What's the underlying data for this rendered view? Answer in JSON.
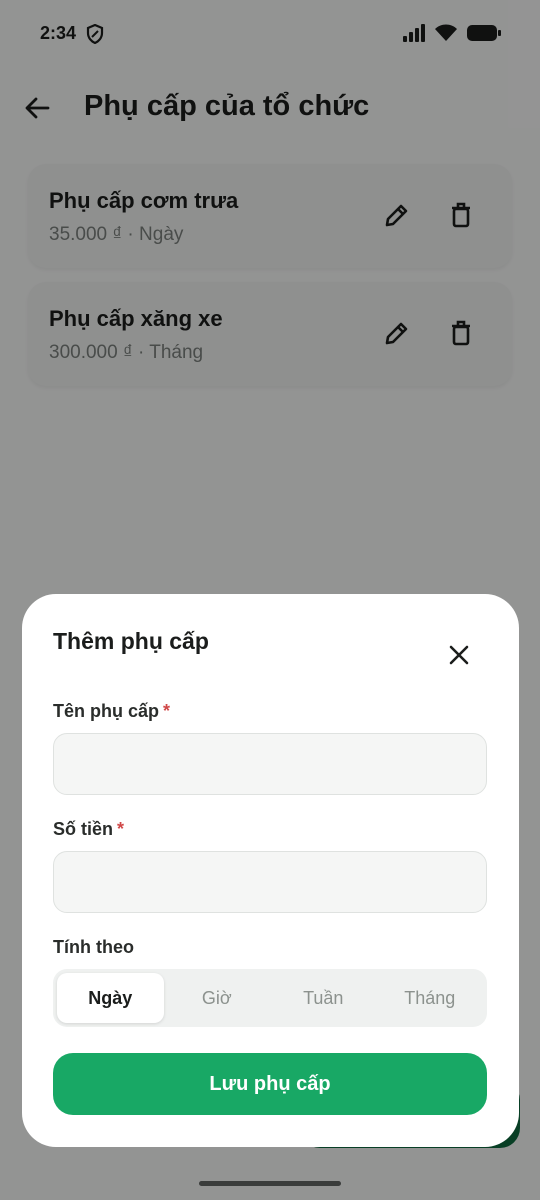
{
  "status": {
    "time": "2:34"
  },
  "header": {
    "title": "Phụ cấp của tổ chức"
  },
  "allowances": [
    {
      "name": "Phụ cấp cơm trưa",
      "detail": "35.000 ₫ · Ngày"
    },
    {
      "name": "Phụ cấp xăng xe",
      "detail": "300.000 ₫ · Tháng"
    }
  ],
  "sheet": {
    "title": "Thêm phụ cấp",
    "name_label": "Tên phụ cấp",
    "name_value": "",
    "amount_label": "Số tiền",
    "amount_value": "",
    "required_mark": "*",
    "period_label": "Tính theo",
    "periods": [
      "Ngày",
      "Giờ",
      "Tuần",
      "Tháng"
    ],
    "selected_period": "Ngày",
    "save_label": "Lưu phụ cấp"
  },
  "colors": {
    "primary": "#18a865",
    "required": "#d04848"
  }
}
